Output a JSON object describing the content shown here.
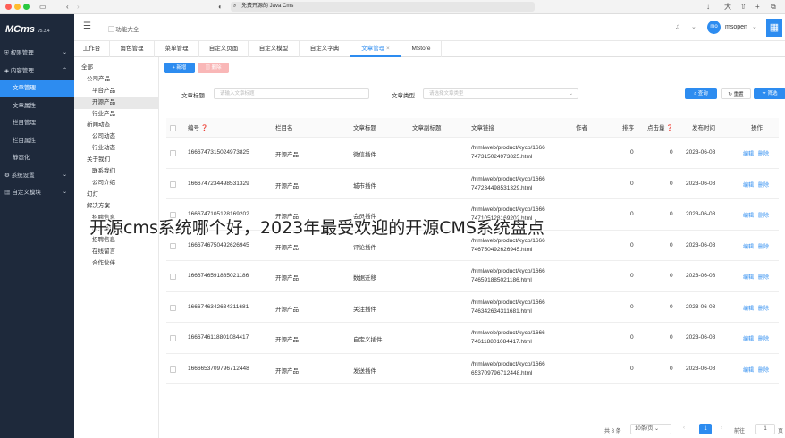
{
  "browser": {
    "url": "免费开源的 Java Cms"
  },
  "sidebar": {
    "brand": "MCms",
    "version": "v5.3.4",
    "items": [
      {
        "label": "权限管理",
        "icon": "shield-icon"
      },
      {
        "label": "内容管理",
        "icon": "layers-icon"
      },
      {
        "label": "文章管理",
        "active": true
      },
      {
        "label": "文章属性"
      },
      {
        "label": "栏目管理"
      },
      {
        "label": "栏目属性"
      },
      {
        "label": "静态化"
      },
      {
        "label": "系统设置",
        "icon": "gear-icon"
      },
      {
        "label": "自定义模块",
        "icon": "grid-icon"
      }
    ]
  },
  "topbar": {
    "breadcrumb": "功能大全",
    "user": "msopen",
    "avatar": "mo"
  },
  "tabs": [
    "工作台",
    "角色管理",
    "菜单管理",
    "自定义页面",
    "自定义模型",
    "自定义字典",
    "文章管理",
    "MStore"
  ],
  "tree": [
    "全部",
    "公司产品",
    "平台产品",
    "开源产品",
    "行业产品",
    "新闻动态",
    "公司动态",
    "行业动态",
    "关于我们",
    "联系我们",
    "公司介绍",
    "幻灯",
    "解决方案",
    "招聘信息",
    "服务案例",
    "招聘信息",
    "在线留言",
    "合作伙伴"
  ],
  "toolbar": {
    "add": "+ 新增",
    "delete": "删除"
  },
  "filters": {
    "title_label": "文章标题",
    "title_placeholder": "请输入文章标题",
    "type_label": "文章类型",
    "type_placeholder": "请选择文章类型",
    "query": "查询",
    "reset": "重置",
    "filter": "筛选"
  },
  "table": {
    "headers": [
      "编号",
      "栏目名",
      "文章标题",
      "文章副标题",
      "文章链接",
      "作者",
      "排序",
      "点击量",
      "发布时间",
      "操作"
    ],
    "rows": [
      {
        "id": "1666747315024973825",
        "col": "开源产品",
        "title": "微信插件",
        "link1": "/html/web/product/kycp/1666",
        "link2": "747315024973825.html",
        "sort": "0",
        "hits": "0",
        "date": "2023-06-08"
      },
      {
        "id": "1666747234498531329",
        "col": "开源产品",
        "title": "城市插件",
        "link1": "/html/web/product/kycp/1666",
        "link2": "747234498531329.html",
        "sort": "0",
        "hits": "0",
        "date": "2023-06-08"
      },
      {
        "id": "1666747105128169202",
        "col": "开源产品",
        "title": "会员插件",
        "link1": "/html/web/product/kycp/1666",
        "link2": "747105128169202.html",
        "sort": "0",
        "hits": "0",
        "date": "2023-06-08"
      },
      {
        "id": "1666746750492626945",
        "col": "开源产品",
        "title": "评论插件",
        "link1": "/html/web/product/kycp/1666",
        "link2": "746750492626945.html",
        "sort": "0",
        "hits": "0",
        "date": "2023-06-08"
      },
      {
        "id": "1666746591885021186",
        "col": "开源产品",
        "title": "数据迁移",
        "link1": "/html/web/product/kycp/1666",
        "link2": "746591885021186.html",
        "sort": "0",
        "hits": "0",
        "date": "2023-06-08"
      },
      {
        "id": "1666746342634311681",
        "col": "开源产品",
        "title": "关注插件",
        "link1": "/html/web/product/kycp/1666",
        "link2": "746342634311681.html",
        "sort": "0",
        "hits": "0",
        "date": "2023-06-08"
      },
      {
        "id": "1666746118801084417",
        "col": "开源产品",
        "title": "自定义插件",
        "link1": "/html/web/product/kycp/1666",
        "link2": "746118801084417.html",
        "sort": "0",
        "hits": "0",
        "date": "2023-06-08"
      },
      {
        "id": "1666653709796712448",
        "col": "开源产品",
        "title": "发送插件",
        "link1": "/html/web/product/kycp/1666",
        "link2": "653709796712448.html",
        "sort": "0",
        "hits": "0",
        "date": "2023-06-08"
      }
    ],
    "edit": "编辑",
    "del": "删除"
  },
  "pager": {
    "total": "共 8 条",
    "size": "10条/页",
    "page": "1",
    "goto": "前往",
    "goto_value": "1",
    "unit": "页"
  },
  "overlay": "开源cms系统哪个好，2023年最受欢迎的开源CMS系统盘点",
  "colors": {
    "accent": "#2d8cf0",
    "sidebar": "#1e293b"
  }
}
